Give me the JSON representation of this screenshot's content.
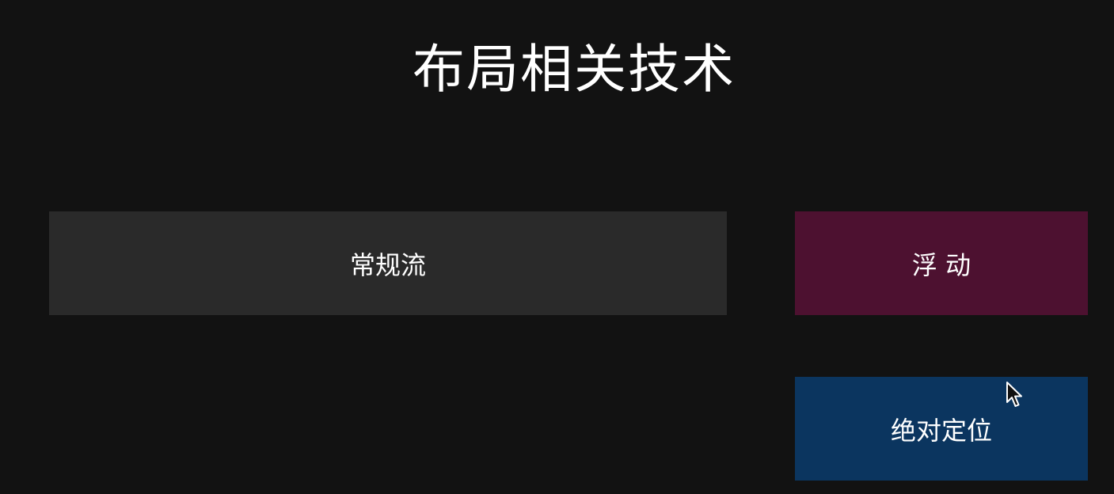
{
  "slide": {
    "title": "布局相关技术"
  },
  "boxes": {
    "normal_flow": {
      "label": "常规流",
      "color": "#2a2a2a"
    },
    "float": {
      "label": "浮 动",
      "color": "#4d1130"
    },
    "absolute_positioning": {
      "label": "绝对定位",
      "color": "#0b355f"
    }
  },
  "background_color": "#121212",
  "cursor": {
    "icon": "mouse-pointer-icon"
  }
}
